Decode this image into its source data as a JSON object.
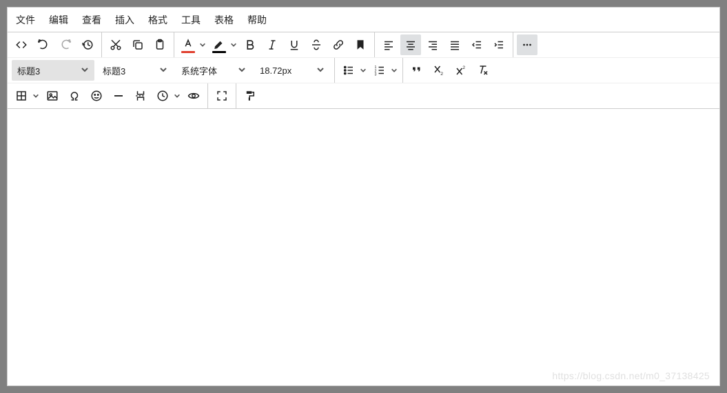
{
  "menu": {
    "file": "文件",
    "edit": "编辑",
    "view": "查看",
    "insert": "插入",
    "format": "格式",
    "tools": "工具",
    "table": "表格",
    "help": "帮助"
  },
  "selects": {
    "heading_boxed": "标题3",
    "heading_plain": "标题3",
    "font_family": "系统字体",
    "font_size": "18.72px"
  },
  "watermark": "https://blog.csdn.net/m0_37138425"
}
